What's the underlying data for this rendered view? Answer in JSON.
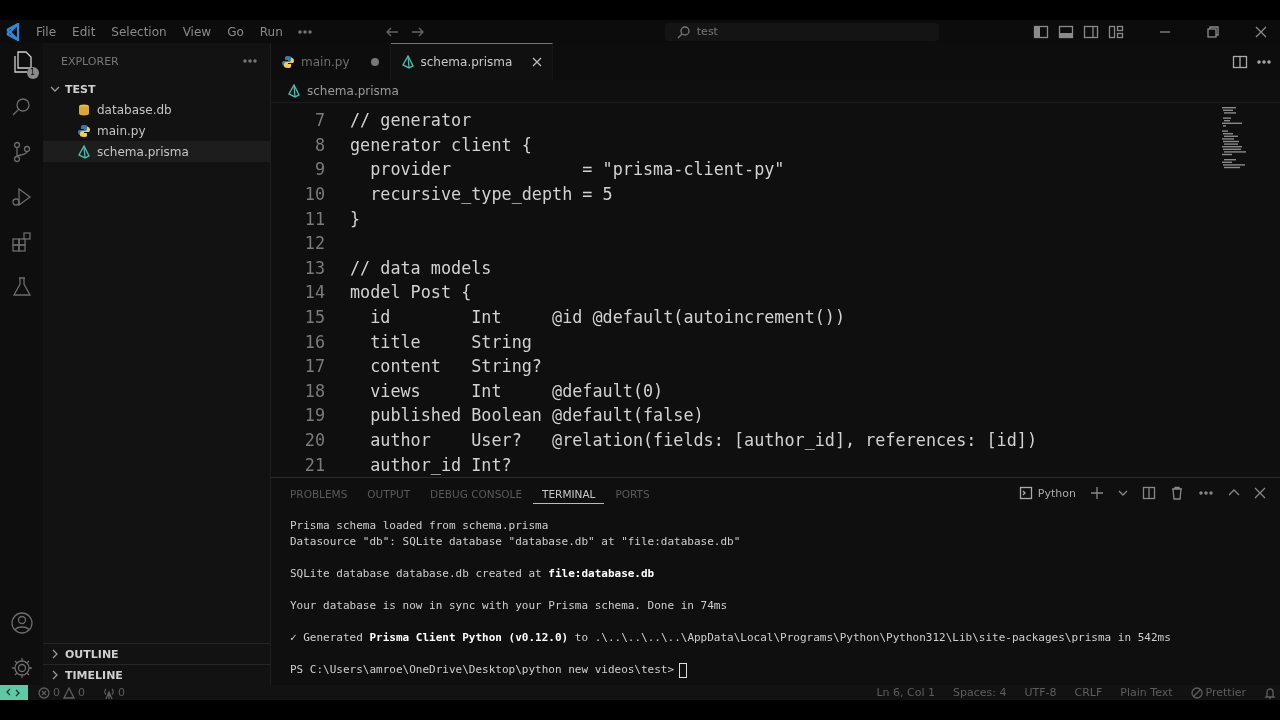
{
  "title_bar": {
    "menu": [
      {
        "label": "File"
      },
      {
        "label": "Edit"
      },
      {
        "label": "Selection"
      },
      {
        "label": "View"
      },
      {
        "label": "Go"
      },
      {
        "label": "Run"
      }
    ],
    "search": "test"
  },
  "activity_bar": {
    "items": [
      {
        "kind": "files",
        "selected": true,
        "badge": "1"
      },
      {
        "kind": "search",
        "selected": false
      },
      {
        "kind": "branch",
        "selected": false
      },
      {
        "kind": "run",
        "selected": false
      },
      {
        "kind": "extensions",
        "selected": false
      },
      {
        "kind": "flask",
        "selected": false
      }
    ]
  },
  "sidebar": {
    "title": "EXPLORER",
    "folder": {
      "name": "TEST",
      "expanded": true,
      "files": [
        {
          "name": "database.db",
          "kind": "database",
          "selected": false
        },
        {
          "name": "main.py",
          "kind": "python",
          "selected": false
        },
        {
          "name": "schema.prisma",
          "kind": "prisma",
          "selected": true
        }
      ]
    },
    "sections": [
      {
        "name": "OUTLINE",
        "expanded": false
      },
      {
        "name": "TIMELINE",
        "expanded": false
      }
    ]
  },
  "tabs": [
    {
      "label": "main.py",
      "kind": "python",
      "selected": false,
      "dirty": true
    },
    {
      "label": "schema.prisma",
      "kind": "prisma",
      "selected": true,
      "dirty": false
    }
  ],
  "breadcrumb": {
    "kind": "prisma",
    "label": "schema.prisma"
  },
  "editor": {
    "lines": [
      {
        "number": "7",
        "text": "// generator"
      },
      {
        "number": "8",
        "text": "generator client {"
      },
      {
        "number": "9",
        "text": "  provider             = \"prisma-client-py\""
      },
      {
        "number": "10",
        "text": "  recursive_type_depth = 5"
      },
      {
        "number": "11",
        "text": "}"
      },
      {
        "number": "12"
      },
      {
        "number": "13",
        "text": "// data models"
      },
      {
        "number": "14",
        "text": "model Post {"
      },
      {
        "number": "15",
        "text": "  id        Int     @id @default(autoincrement())"
      },
      {
        "number": "16",
        "text": "  title     String"
      },
      {
        "number": "17",
        "text": "  content   String?"
      },
      {
        "number": "18",
        "text": "  views     Int     @default(0)"
      },
      {
        "number": "19",
        "text": "  published Boolean @default(false)"
      },
      {
        "number": "20",
        "text": "  author    User?   @relation(fields: [author_id], references: [id])"
      },
      {
        "number": "21",
        "text": "  author_id Int?"
      }
    ]
  },
  "panel": {
    "tabs": [
      {
        "label": "PROBLEMS",
        "selected": false
      },
      {
        "label": "OUTPUT",
        "selected": false
      },
      {
        "label": "DEBUG CONSOLE",
        "selected": false
      },
      {
        "label": "TERMINAL",
        "selected": true
      },
      {
        "label": "PORTS",
        "selected": false
      }
    ],
    "profile": "Python",
    "blocks": [
      [
        "Prisma schema loaded from schema.prisma",
        "Datasource \"db\": SQLite database \"database.db\" at \"file:database.db\""
      ],
      [
        "SQLite database database.db created at **file:database.db**"
      ],
      [
        "Your database is now in sync with your Prisma schema. Done in 74ms"
      ],
      [
        "✓ Generated **Prisma Client Python (v0.12.0)** to .\\..\\..\\..\\..\\AppData\\Local\\Programs\\Python\\Python312\\Lib\\site-packages\\prisma in 542ms"
      ]
    ],
    "prompt": "PS C:\\Users\\amroe\\OneDrive\\Desktop\\python new videos\\test>"
  },
  "status_bar": {
    "errors": "0",
    "warnings": "0",
    "ports": "0",
    "items": [
      "Ln 6, Col 1",
      "Spaces: 4",
      "UTF-8",
      "CRLF",
      "Plain Text"
    ],
    "prettier": "Prettier"
  }
}
